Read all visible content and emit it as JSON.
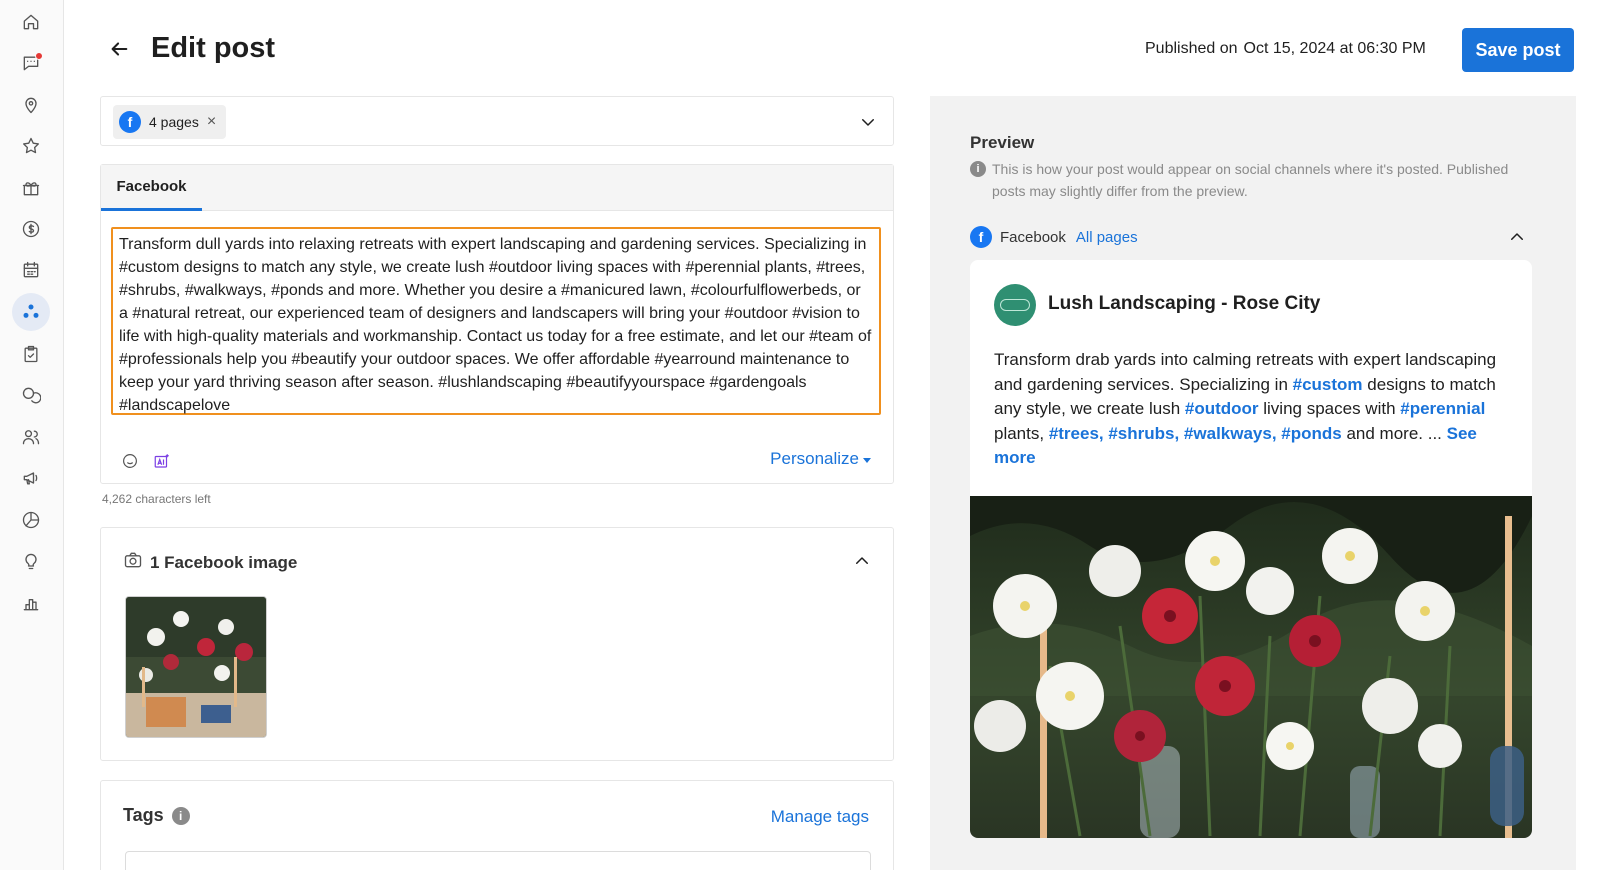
{
  "header": {
    "title": "Edit post",
    "published_label": "Published on",
    "published_date": "Oct 15, 2024 at 06:30 PM",
    "save_label": "Save post"
  },
  "sidebar": {
    "items": [
      {
        "icon": "home-icon"
      },
      {
        "icon": "messages-icon",
        "has_notification": true
      },
      {
        "icon": "location-pin-icon"
      },
      {
        "icon": "star-icon"
      },
      {
        "icon": "gift-icon"
      },
      {
        "icon": "dollar-icon"
      },
      {
        "icon": "calendar-icon"
      },
      {
        "icon": "social-icon",
        "active": true
      },
      {
        "icon": "clipboard-check-icon"
      },
      {
        "icon": "chat-bubbles-icon"
      },
      {
        "icon": "users-icon"
      },
      {
        "icon": "megaphone-icon"
      },
      {
        "icon": "pie-chart-icon"
      },
      {
        "icon": "lightbulb-icon"
      },
      {
        "icon": "bar-chart-icon"
      }
    ]
  },
  "pages_selector": {
    "chip_icon": "f",
    "chip_label": "4 pages",
    "chip_remove": "×"
  },
  "editor": {
    "tab_label": "Facebook",
    "text": "Transform dull yards into relaxing retreats with expert landscaping and gardening services. Specializing in #custom designs to match any style, we create lush #outdoor living spaces with #perennial plants, #trees, #shrubs, #walkways, #ponds and more. Whether you desire a #manicured lawn, #colourfulflowerbeds, or a #natural retreat, our experienced team of designers and landscapers will bring your #outdoor #vision to life with high-quality materials and workmanship. Contact us today for a free estimate, and let our #team of #professionals help you #beautify your outdoor spaces. We offer affordable #yearround maintenance to keep your yard thriving season after season. #lushlandscaping #beautifyyourspace #gardengoals #landscapelove",
    "personalize_label": "Personalize",
    "chars_left": "4,262 characters left"
  },
  "image_section": {
    "title": "1 Facebook image"
  },
  "tags": {
    "title": "Tags",
    "info": "i",
    "manage_label": "Manage tags"
  },
  "preview": {
    "title": "Preview",
    "info": "i",
    "note": "This is how your post would appear on social channels where it's posted. Published posts may slightly differ from the preview.",
    "channel_icon": "f",
    "channel_name": "Facebook",
    "channel_scope": "All pages",
    "page_name": "Lush Landscaping - Rose City",
    "text_parts": [
      {
        "t": "Transform drab yards into calming retreats with expert landscaping and gardening services. Specializing in ",
        "tag": false
      },
      {
        "t": "#custom",
        "tag": true
      },
      {
        "t": " designs to match any style, we create lush ",
        "tag": false
      },
      {
        "t": "#outdoor",
        "tag": true
      },
      {
        "t": " living spaces with ",
        "tag": false
      },
      {
        "t": "#perennial",
        "tag": true
      },
      {
        "t": " plants, ",
        "tag": false
      },
      {
        "t": "#trees, #shrubs, #walkways, #ponds",
        "tag": true
      },
      {
        "t": " and more. ... ",
        "tag": false
      }
    ],
    "see_more": "See more"
  },
  "colors": {
    "accent": "#1a73d9",
    "facebook": "#1877f2",
    "highlight_border": "#f0901e",
    "avatar": "#2f8f72"
  }
}
